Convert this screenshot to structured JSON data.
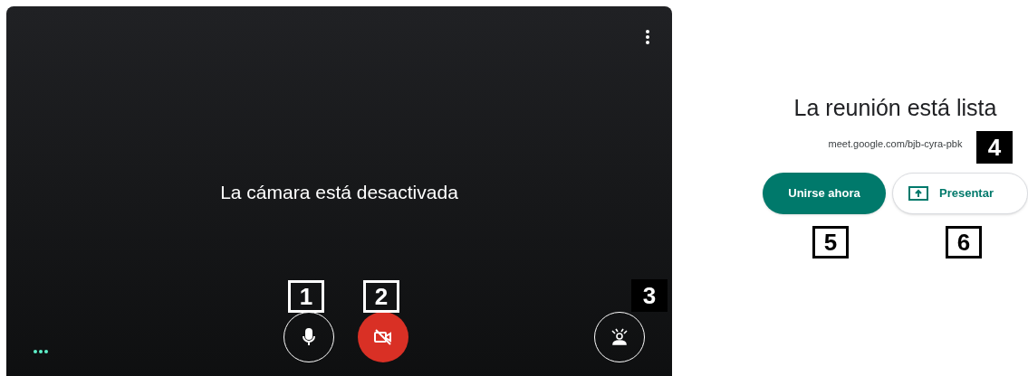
{
  "video": {
    "message": "La cámara está desactivada",
    "mic": {
      "on": true
    },
    "camera": {
      "on": false
    }
  },
  "join": {
    "title": "La reunión está lista",
    "link": "meet.google.com/bjb-cyra-pbk",
    "buttons": [
      {
        "label": "Unirse ahora",
        "kind": "primary"
      },
      {
        "label": "Presentar",
        "kind": "present"
      }
    ]
  },
  "callouts": [
    {
      "label": "1",
      "kind": "outline"
    },
    {
      "label": "2",
      "kind": "outline"
    },
    {
      "label": "3",
      "kind": "dark"
    },
    {
      "label": "4",
      "kind": "dark"
    },
    {
      "label": "5",
      "kind": "light"
    },
    {
      "label": "6",
      "kind": "light"
    }
  ]
}
